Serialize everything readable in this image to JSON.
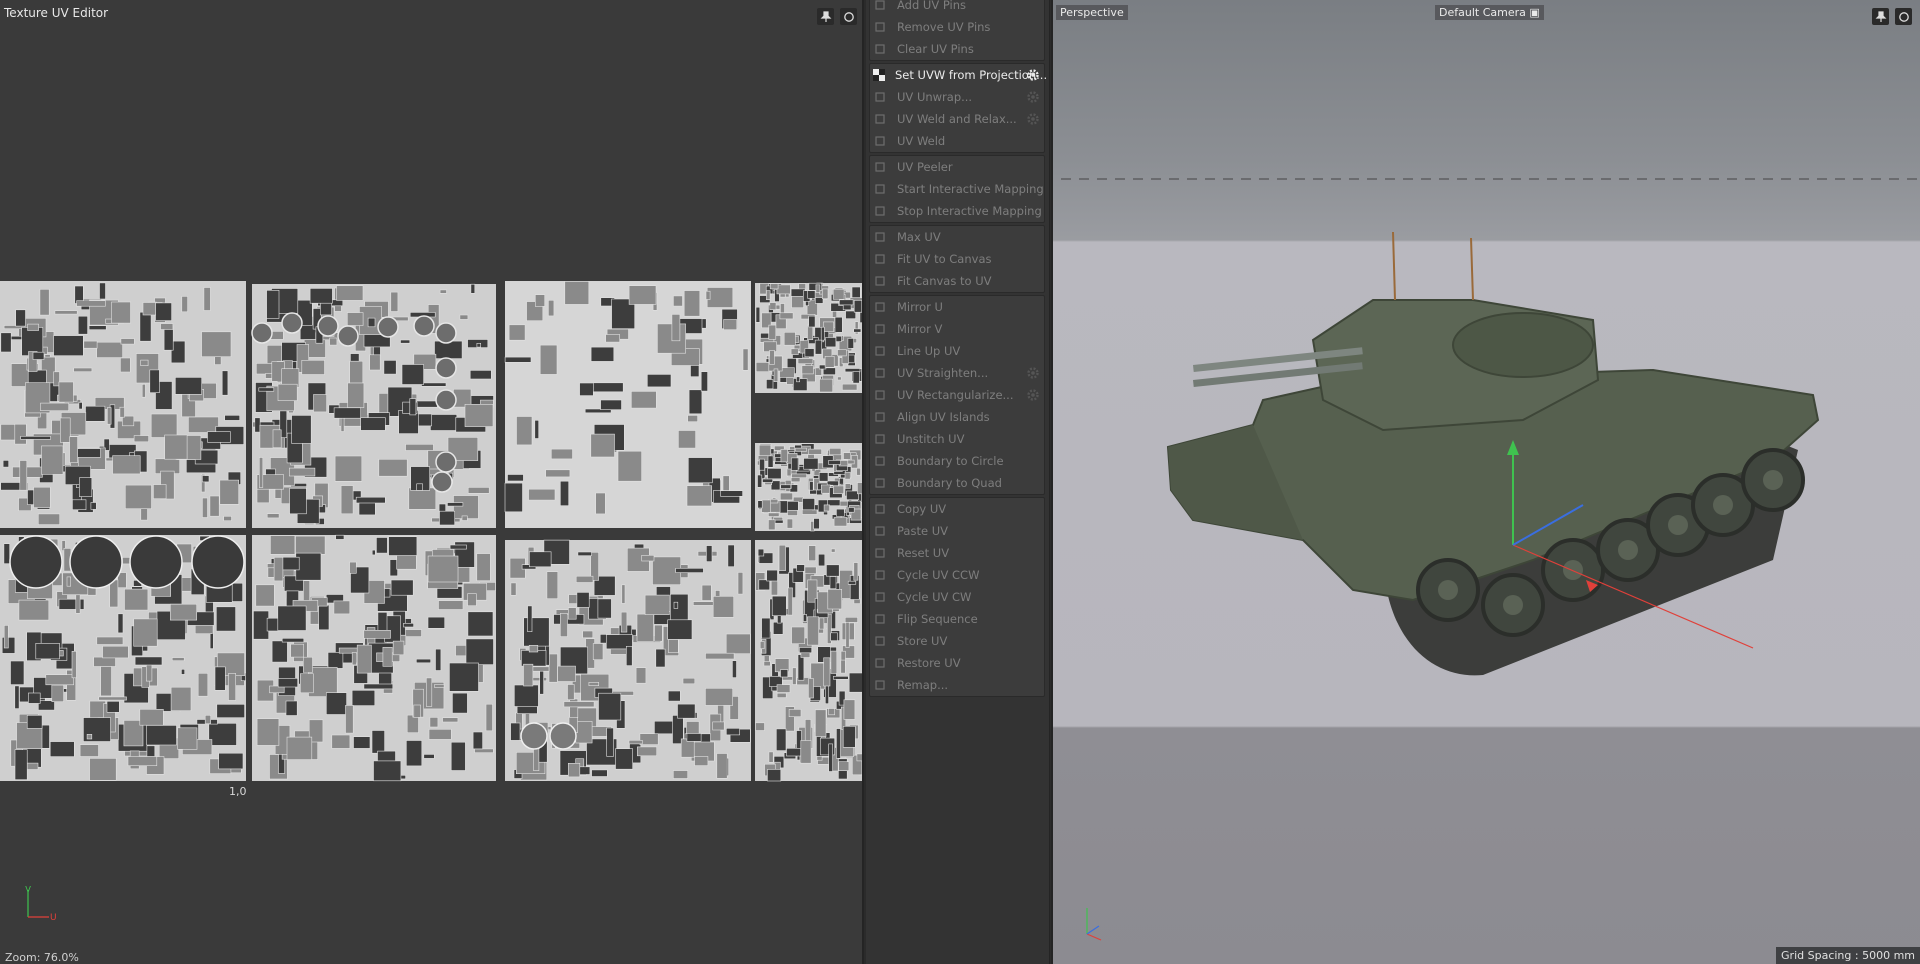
{
  "uv_editor": {
    "title": "Texture UV Editor",
    "coord_label": "1,0",
    "zoom_label": "Zoom: 76.0%",
    "axis_v": "V",
    "axis_u": "U"
  },
  "uv_commands": {
    "groups": [
      [
        {
          "label": "Add UV Pins",
          "icon": "pin-add-icon",
          "active": false,
          "gear": false
        },
        {
          "label": "Remove UV Pins",
          "icon": "pin-remove-icon",
          "active": false,
          "gear": false
        },
        {
          "label": "Clear UV Pins",
          "icon": "pin-clear-icon",
          "active": false,
          "gear": false
        }
      ],
      [
        {
          "label": "Set UVW from Projection...",
          "icon": "checker-icon",
          "active": true,
          "gear": true
        },
        {
          "label": "UV Unwrap...",
          "icon": "unwrap-icon",
          "active": false,
          "gear": true
        },
        {
          "label": "UV Weld and Relax...",
          "icon": "weld-relax-icon",
          "active": false,
          "gear": true
        },
        {
          "label": "UV Weld",
          "icon": "weld-icon",
          "active": false,
          "gear": false
        }
      ],
      [
        {
          "label": "UV Peeler",
          "icon": "peeler-icon",
          "active": false,
          "gear": false
        },
        {
          "label": "Start Interactive Mapping",
          "icon": "mapping-start-icon",
          "active": false,
          "gear": false
        },
        {
          "label": "Stop Interactive Mapping",
          "icon": "mapping-stop-icon",
          "active": false,
          "gear": false
        }
      ],
      [
        {
          "label": "Max UV",
          "icon": "max-uv-icon",
          "active": false,
          "gear": false
        },
        {
          "label": "Fit UV to Canvas",
          "icon": "fit-uv-icon",
          "active": false,
          "gear": false
        },
        {
          "label": "Fit Canvas to UV",
          "icon": "fit-canvas-icon",
          "active": false,
          "gear": false
        }
      ],
      [
        {
          "label": "Mirror U",
          "icon": "mirror-u-icon",
          "active": false,
          "gear": false
        },
        {
          "label": "Mirror V",
          "icon": "mirror-v-icon",
          "active": false,
          "gear": false
        },
        {
          "label": "Line Up UV",
          "icon": "line-up-icon",
          "active": false,
          "gear": false
        },
        {
          "label": "UV Straighten...",
          "icon": "straighten-icon",
          "active": false,
          "gear": true
        },
        {
          "label": "UV Rectangularize...",
          "icon": "rectangularize-icon",
          "active": false,
          "gear": true
        },
        {
          "label": "Align UV Islands",
          "icon": "align-icon",
          "active": false,
          "gear": false
        },
        {
          "label": "Unstitch UV",
          "icon": "unstitch-icon",
          "active": false,
          "gear": false
        },
        {
          "label": "Boundary to Circle",
          "icon": "circle-icon",
          "active": false,
          "gear": false
        },
        {
          "label": "Boundary to Quad",
          "icon": "quad-icon",
          "active": false,
          "gear": false
        }
      ],
      [
        {
          "label": "Copy UV",
          "icon": "copy-icon",
          "active": false,
          "gear": false
        },
        {
          "label": "Paste UV",
          "icon": "paste-icon",
          "active": false,
          "gear": false
        },
        {
          "label": "Reset UV",
          "icon": "reset-icon",
          "active": false,
          "gear": false
        },
        {
          "label": "Cycle UV CCW",
          "icon": "cycle-ccw-icon",
          "active": false,
          "gear": false
        },
        {
          "label": "Cycle UV CW",
          "icon": "cycle-cw-icon",
          "active": false,
          "gear": false
        },
        {
          "label": "Flip Sequence",
          "icon": "flip-icon",
          "active": false,
          "gear": false
        },
        {
          "label": "Store UV",
          "icon": "store-icon",
          "active": false,
          "gear": false
        },
        {
          "label": "Restore UV",
          "icon": "restore-icon",
          "active": false,
          "gear": false
        },
        {
          "label": "Remap...",
          "icon": "remap-icon",
          "active": false,
          "gear": false
        }
      ]
    ]
  },
  "viewport": {
    "title": "Perspective",
    "camera": "Default Camera",
    "grid_spacing": "Grid Spacing : 5000 mm"
  },
  "colors": {
    "axis_x": "#e0403a",
    "axis_y": "#3fc24f",
    "axis_z": "#3a6ee0",
    "tank_green": "#56604f"
  }
}
